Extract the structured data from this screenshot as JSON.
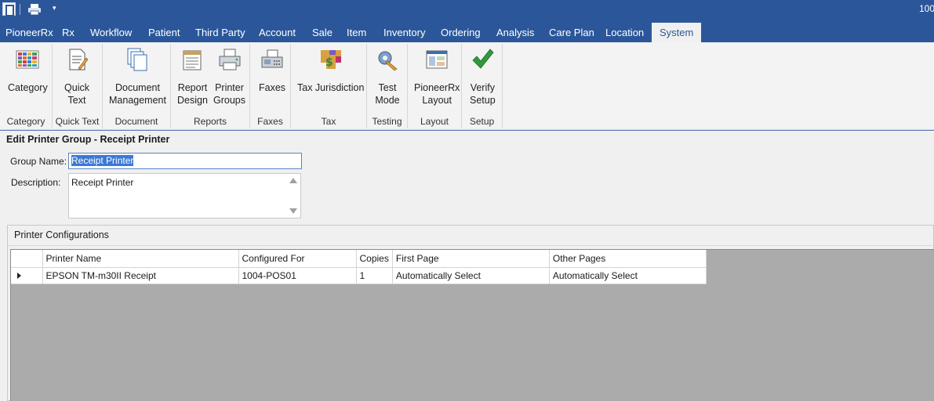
{
  "titlebar": {
    "title": "100"
  },
  "menu": {
    "tabs": [
      "PioneerRx",
      "Rx",
      "Workflow",
      "Patient",
      "Third Party",
      "Account",
      "Sale",
      "Item",
      "Inventory",
      "Ordering",
      "Analysis",
      "Care Plan",
      "Location",
      "System"
    ],
    "active": "System"
  },
  "ribbon": {
    "groups": [
      {
        "label": "Category",
        "buttons": [
          {
            "line1": "Category",
            "line2": "",
            "icon": "category-grid-icon"
          }
        ]
      },
      {
        "label": "Quick Text",
        "buttons": [
          {
            "line1": "Quick",
            "line2": "Text",
            "icon": "quick-text-icon"
          }
        ]
      },
      {
        "label": "Document",
        "buttons": [
          {
            "line1": "Document",
            "line2": "Management",
            "icon": "documents-icon"
          }
        ]
      },
      {
        "label": "Reports",
        "buttons": [
          {
            "line1": "Report",
            "line2": "Design",
            "icon": "report-design-icon"
          },
          {
            "line1": "Printer",
            "line2": "Groups",
            "icon": "printer-icon"
          }
        ]
      },
      {
        "label": "Faxes",
        "buttons": [
          {
            "line1": "Faxes",
            "line2": "",
            "icon": "fax-icon"
          }
        ]
      },
      {
        "label": "Tax",
        "buttons": [
          {
            "line1": "Tax Jurisdiction",
            "line2": "",
            "icon": "tax-jurisdiction-icon"
          }
        ]
      },
      {
        "label": "Testing",
        "buttons": [
          {
            "line1": "Test",
            "line2": "Mode",
            "icon": "test-mode-icon"
          }
        ]
      },
      {
        "label": "Layout",
        "buttons": [
          {
            "line1": "PioneerRx",
            "line2": "Layout",
            "icon": "layout-icon"
          }
        ]
      },
      {
        "label": "Setup",
        "buttons": [
          {
            "line1": "Verify",
            "line2": "Setup",
            "icon": "checkmark-icon"
          }
        ]
      }
    ]
  },
  "form": {
    "heading": "Edit Printer Group - Receipt Printer",
    "group_name_label": "Group Name:",
    "group_name_value": "Receipt Printer",
    "description_label": "Description:",
    "description_value": "Receipt Printer"
  },
  "printer_config": {
    "title": "Printer Configurations",
    "columns": [
      "Printer Name",
      "Configured For",
      "Copies",
      "First Page",
      "Other Pages"
    ],
    "rows": [
      {
        "printer_name": "EPSON TM-m30II Receipt",
        "configured_for": "1004-POS01",
        "copies": "1",
        "first_page": "Automatically Select",
        "other_pages": "Automatically Select"
      }
    ]
  },
  "colors": {
    "accent": "#2b579a",
    "grid_background": "#ababab",
    "selection": "#3a78d4"
  }
}
